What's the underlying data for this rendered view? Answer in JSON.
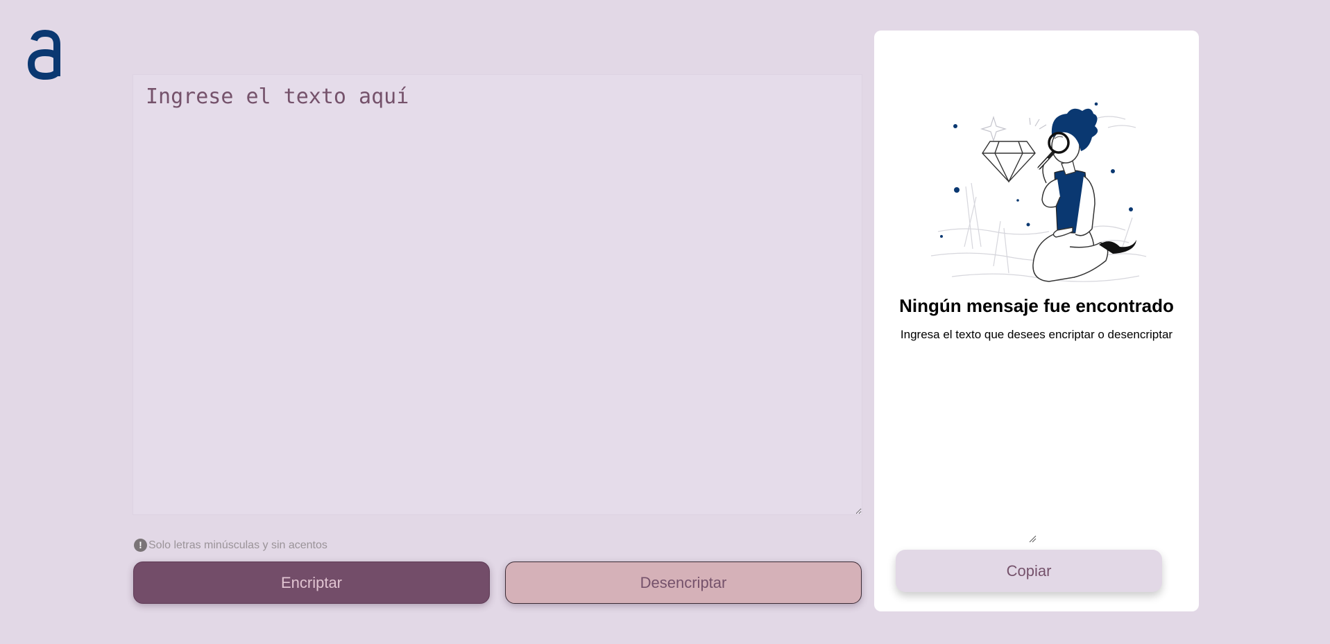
{
  "logo": {
    "glyph": "a",
    "color": "#0a3871"
  },
  "encoder": {
    "placeholder": "Ingrese el texto aquí",
    "value": "",
    "hint_text": "Solo letras minúsculas y sin acentos",
    "hint_icon": "exclamation-icon",
    "encrypt_label": "Encriptar",
    "decrypt_label": "Desencriptar"
  },
  "output_panel": {
    "illustration": "person-with-magnifying-glass",
    "title": "Ningún mensaje fue encontrado",
    "description": "Ingresa el texto que desees encriptar o desencriptar",
    "copy_label": "Copiar"
  },
  "colors": {
    "background": "#e2d8e6",
    "textarea_bg": "#e5dcea",
    "text_accent": "#75526b",
    "encrypt_button": "#734d69",
    "encrypt_text": "#e1c4d2",
    "decrypt_button": "#d5b1b8",
    "panel_bg": "#ffffff",
    "illustration_blue": "#0a3871"
  }
}
